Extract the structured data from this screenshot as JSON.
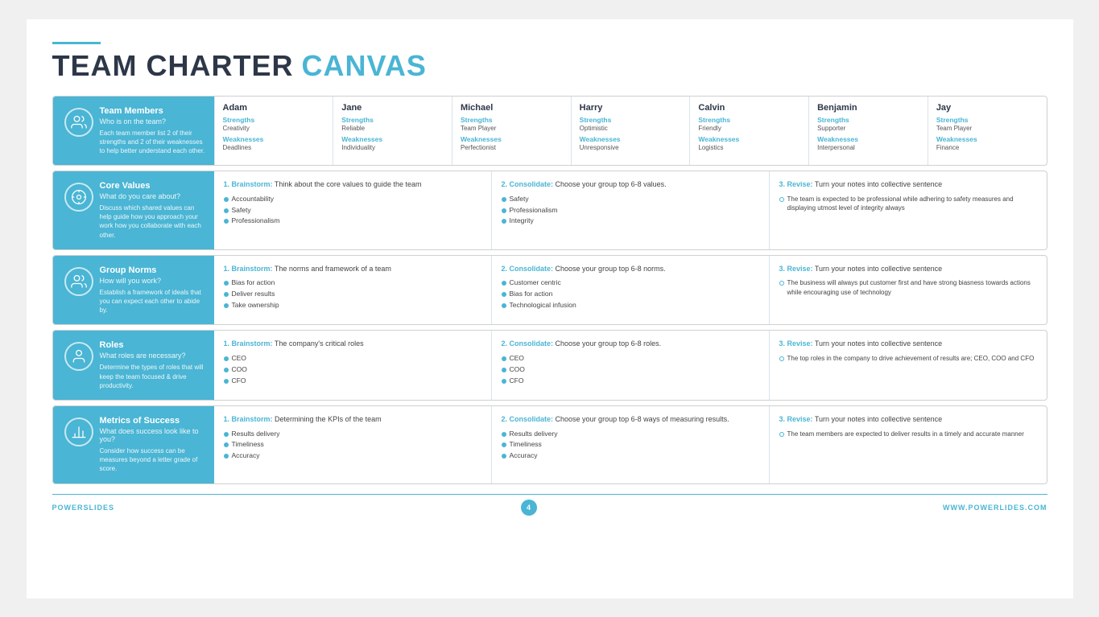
{
  "title": {
    "bar": true,
    "dark": "TEAM CHARTER",
    "blue": "CANVAS"
  },
  "rows": [
    {
      "id": "team-members",
      "icon": "🤝",
      "left": {
        "title": "Team Members",
        "subtitle": "Who is on the team?",
        "desc": "Each team member list 2 of their strengths and 2 of their weaknesses to help better understand each other."
      },
      "type": "members",
      "members": [
        {
          "name": "Adam",
          "strengthLabel": "Strengths",
          "strength": "Creativity",
          "weaknessLabel": "Weaknesses",
          "weakness": "Deadlines"
        },
        {
          "name": "Jane",
          "strengthLabel": "Strengths",
          "strength": "Reliable",
          "weaknessLabel": "Weaknesses",
          "weakness": "Individuality"
        },
        {
          "name": "Michael",
          "strengthLabel": "Strengths",
          "strength": "Team Player",
          "weaknessLabel": "Weaknesses",
          "weakness": "Perfectionist"
        },
        {
          "name": "Harry",
          "strengthLabel": "Strengths",
          "strength": "Optimistic",
          "weaknessLabel": "Weaknesses",
          "weakness": "Unresponsive"
        },
        {
          "name": "Calvin",
          "strengthLabel": "Strengths",
          "strength": "Friendly",
          "weaknessLabel": "Weaknesses",
          "weakness": "Logistics"
        },
        {
          "name": "Benjamin",
          "strengthLabel": "Strengths",
          "strength": "Supporter",
          "weaknessLabel": "Weaknesses",
          "weakness": "Interpersonal"
        },
        {
          "name": "Jay",
          "strengthLabel": "Strengths",
          "strength": "Team Player",
          "weaknessLabel": "Weaknesses",
          "weakness": "Finance"
        }
      ]
    },
    {
      "id": "core-values",
      "icon": "⚛",
      "left": {
        "title": "Core Values",
        "subtitle": "What do you care about?",
        "desc": "Discuss which shared values can help guide how you approach your work how you collaborate with each other."
      },
      "type": "three-col",
      "cols": [
        {
          "headerBold": "1. Brainstorm:",
          "headerNormal": " Think about the core values to guide the team",
          "bullets": [
            "Accountability",
            "Safety",
            "Professionalism"
          ]
        },
        {
          "headerBold": "2. Consolidate:",
          "headerNormal": " Choose your group top 6-8 values.",
          "bullets": [
            "Safety",
            "Professionalism",
            "Integrity"
          ]
        },
        {
          "headerBold": "3. Revise:",
          "headerNormal": " Turn your notes into collective sentence",
          "revise": "The team is expected to be professional while adhering to safety measures and displaying utmost level of integrity always"
        }
      ]
    },
    {
      "id": "group-norms",
      "icon": "👥",
      "left": {
        "title": "Group Norms",
        "subtitle": "How will you work?",
        "desc": "Establish a framework of ideals that you can expect each other to abide by."
      },
      "type": "three-col",
      "cols": [
        {
          "headerBold": "1. Brainstorm:",
          "headerNormal": " The norms and framework of a team",
          "bullets": [
            "Bias for action",
            "Deliver results",
            "Take ownership"
          ]
        },
        {
          "headerBold": "2. Consolidate:",
          "headerNormal": " Choose your group top 6-8 norms.",
          "bullets": [
            "Customer centric",
            "Bias for action",
            "Technological infusion"
          ]
        },
        {
          "headerBold": "3. Revise:",
          "headerNormal": " Turn your notes into collective sentence",
          "revise": "The business will always put customer first and have strong biasness towards actions while encouraging use of technology"
        }
      ]
    },
    {
      "id": "roles",
      "icon": "👤",
      "left": {
        "title": "Roles",
        "subtitle": "What roles are necessary?",
        "desc": "Determine the types of roles that will keep the team focused & drive productivity."
      },
      "type": "three-col",
      "cols": [
        {
          "headerBold": "1. Brainstorm:",
          "headerNormal": " The company's critical roles",
          "bullets": [
            "CEO",
            "COO",
            "CFO"
          ]
        },
        {
          "headerBold": "2. Consolidate:",
          "headerNormal": " Choose your group top 6-8 roles.",
          "bullets": [
            "CEO",
            "COO",
            "CFO"
          ]
        },
        {
          "headerBold": "3. Revise:",
          "headerNormal": " Turn your notes into collective sentence",
          "revise": "The top roles in the company to drive achievement of results are; CEO, COO and CFO"
        }
      ]
    },
    {
      "id": "metrics",
      "icon": "📊",
      "left": {
        "title": "Metrics of Success",
        "subtitle": "What does success look like to you?",
        "desc": "Consider how success can be measures beyond a letter grade of score."
      },
      "type": "three-col",
      "cols": [
        {
          "headerBold": "1. Brainstorm:",
          "headerNormal": " Determining the KPIs of the team",
          "bullets": [
            "Results delivery",
            "Timeliness",
            "Accuracy"
          ]
        },
        {
          "headerBold": "2. Consolidate:",
          "headerNormal": " Choose your group top 6-8 ways of measuring results.",
          "bullets": [
            "Results delivery",
            "Timeliness",
            "Accuracy"
          ]
        },
        {
          "headerBold": "3. Revise:",
          "headerNormal": " Turn your notes into collective sentence",
          "revise": "The team members are expected to deliver results in a timely and accurate manner"
        }
      ]
    }
  ],
  "footer": {
    "left_brand": "POWER",
    "left_suffix": "SLIDES",
    "page": "4",
    "right": "WWW.POWERLIDES.COM"
  }
}
